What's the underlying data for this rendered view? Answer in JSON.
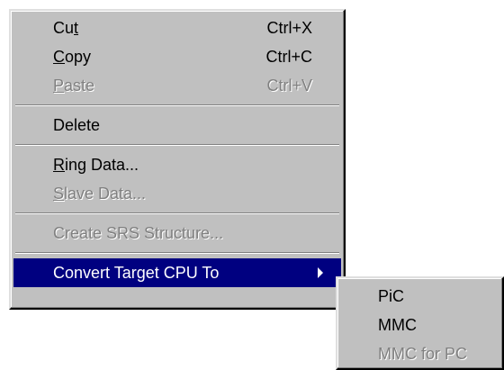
{
  "context_menu": {
    "items": {
      "cut": {
        "pre": "Cu",
        "mn": "t",
        "post": "",
        "shortcut": "Ctrl+X",
        "enabled": true
      },
      "copy": {
        "pre": "",
        "mn": "C",
        "post": "opy",
        "shortcut": "Ctrl+C",
        "enabled": true
      },
      "paste": {
        "pre": "",
        "mn": "P",
        "post": "aste",
        "shortcut": "Ctrl+V",
        "enabled": false
      },
      "delete": {
        "label": "Delete",
        "enabled": true
      },
      "ring_data": {
        "pre": "",
        "mn": "R",
        "post": "ing Data...",
        "enabled": true
      },
      "slave_data": {
        "pre": "",
        "mn": "S",
        "post": "lave Data...",
        "enabled": false
      },
      "create_srs": {
        "label": "Create SRS Structure...",
        "enabled": false
      },
      "convert_cpu": {
        "label": "Convert Target CPU To",
        "enabled": true,
        "highlighted": true
      }
    }
  },
  "submenu": {
    "items": {
      "pic": {
        "label": "PiC",
        "enabled": true
      },
      "mmc": {
        "label": "MMC",
        "enabled": true
      },
      "mmc_for_pc": {
        "label": "MMC for PC",
        "enabled": false
      }
    }
  },
  "colors": {
    "menu_face": "#c0c0c0",
    "highlight": "#000080",
    "disabled_text": "#808080"
  },
  "icons": {
    "submenu_arrow": "triangle-right"
  }
}
